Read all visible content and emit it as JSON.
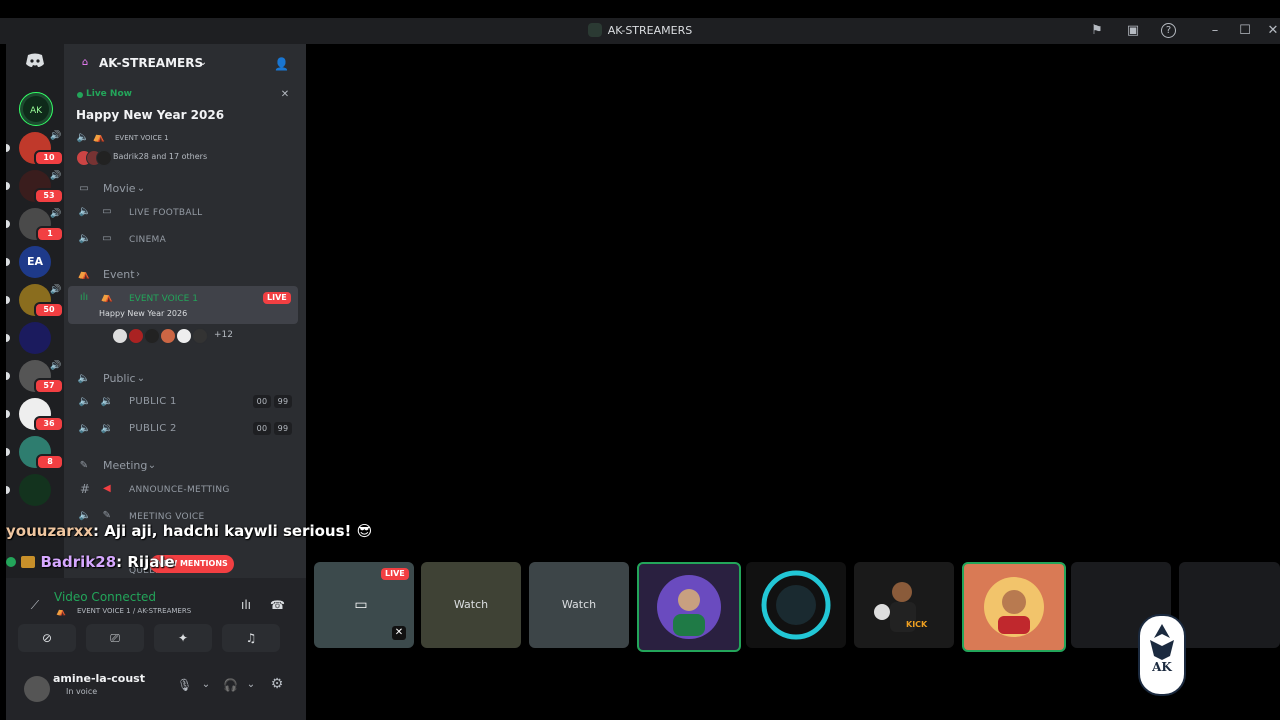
{
  "window": {
    "title": "AK-STREAMERS",
    "icons": [
      "flag-icon",
      "inbox-icon",
      "help-icon",
      "minimize-icon",
      "maximize-icon",
      "close-icon"
    ]
  },
  "server": {
    "name": "AK-STREAMERS"
  },
  "rail": {
    "badges": [
      "10",
      "53",
      "1",
      "50",
      "57",
      "36",
      "8"
    ],
    "logo_text": "EA"
  },
  "event": {
    "status": "Live Now",
    "title": "Happy New Year 2026",
    "channel": "EVENT VOICE 1",
    "attendees": "Badrik28 and 17 others"
  },
  "categories": {
    "movie": "Movie",
    "event": "Event",
    "public": "Public",
    "meeting": "Meeting"
  },
  "channels": {
    "live_football": "LIVE FOOTBALL",
    "cinema": "CINEMA",
    "event_voice": "EVENT VOICE 1",
    "event_voice_live": "LIVE",
    "event_voice_sub": "Happy New Year 2026",
    "event_voice_more": "+12",
    "public1": "PUBLIC 1",
    "public1_count_a": "00",
    "public1_count_b": "99",
    "public2": "PUBLIC 2",
    "public2_count_a": "00",
    "public2_count_b": "99",
    "announce": "ANNOUNCE-METTING",
    "meeting_voice": "MEETING VOICE",
    "queue": "QUEEN 1"
  },
  "mentions_pill": "NEW MENTIONS",
  "chat": [
    {
      "user": "youuzarxx",
      "text": ": Aji aji, hadchi kaywli serious! 😎"
    },
    {
      "user": "Badrik28",
      "text": ": Rijale"
    }
  ],
  "voice_panel": {
    "status": "Video Connected",
    "location": "EVENT VOICE 1 / AK-STREAMERS"
  },
  "user": {
    "name": "amine-la-coust",
    "status": "In voice"
  },
  "tiles": {
    "live": "LIVE",
    "watch1": "Watch",
    "watch2": "Watch",
    "kick": "KICK"
  },
  "watermark": "AK"
}
